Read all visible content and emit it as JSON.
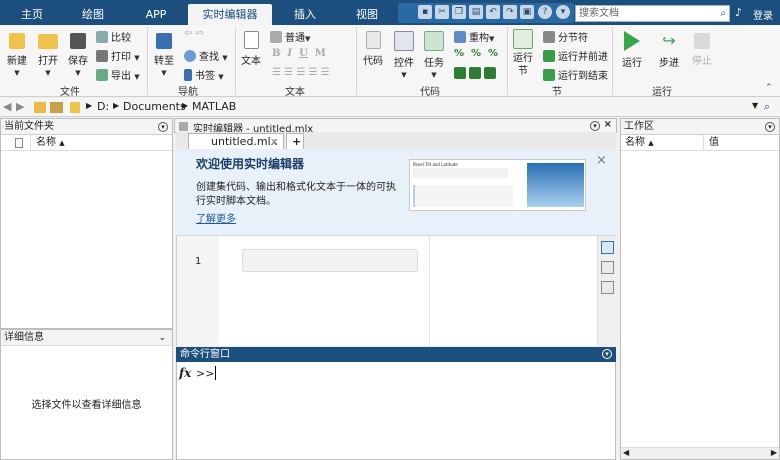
{
  "tabs": [
    {
      "label": "主页"
    },
    {
      "label": "绘图"
    },
    {
      "label": "APP"
    },
    {
      "label": "实时编辑器"
    },
    {
      "label": "插入"
    },
    {
      "label": "视图"
    }
  ],
  "search": {
    "placeholder": "搜索文档"
  },
  "user": {
    "label": "登录"
  },
  "ribbon": {
    "file": {
      "new": "新建",
      "open": "打开",
      "save": "保存",
      "compare": "比较",
      "print": "打印",
      "export": "导出",
      "group": "文件"
    },
    "nav": {
      "goto": "转至",
      "find": "查找",
      "bookmark": "书签",
      "group": "导航"
    },
    "text": {
      "text": "文本",
      "style": "普通",
      "group": "文本"
    },
    "code": {
      "code": "代码",
      "control": "控件",
      "task": "任务",
      "refactor": "重构",
      "group": "代码"
    },
    "section": {
      "run_section": "运行节",
      "section_break": "分节符",
      "run_advance": "运行并前进",
      "run_to_end": "运行到结束",
      "group": "节"
    },
    "run": {
      "run": "运行",
      "step": "步进",
      "stop": "停止",
      "group": "运行"
    }
  },
  "address": {
    "drive": "D:",
    "p1": "Documents",
    "p2": "MATLAB"
  },
  "current_folder": {
    "title": "当前文件夹",
    "col_name": "名称"
  },
  "details": {
    "title": "详细信息",
    "empty": "选择文件以查看详细信息"
  },
  "editor": {
    "title": "实时编辑器 - untitled.mlx",
    "tab": "untitled.mlx",
    "plus": "+",
    "welcome_title": "欢迎使用实时编辑器",
    "welcome_body1": "创建集代码、输出和格式化文本于一体的可执",
    "welcome_body2": "行实时脚本文档。",
    "learn_more": "了解更多",
    "preview_title": "Panel Tilt and Latitude",
    "line_no": "1"
  },
  "command": {
    "title": "命令行窗口",
    "fx": "fx",
    "prompt": ">>"
  },
  "workspace": {
    "title": "工作区",
    "col_name": "名称",
    "col_value": "值"
  }
}
